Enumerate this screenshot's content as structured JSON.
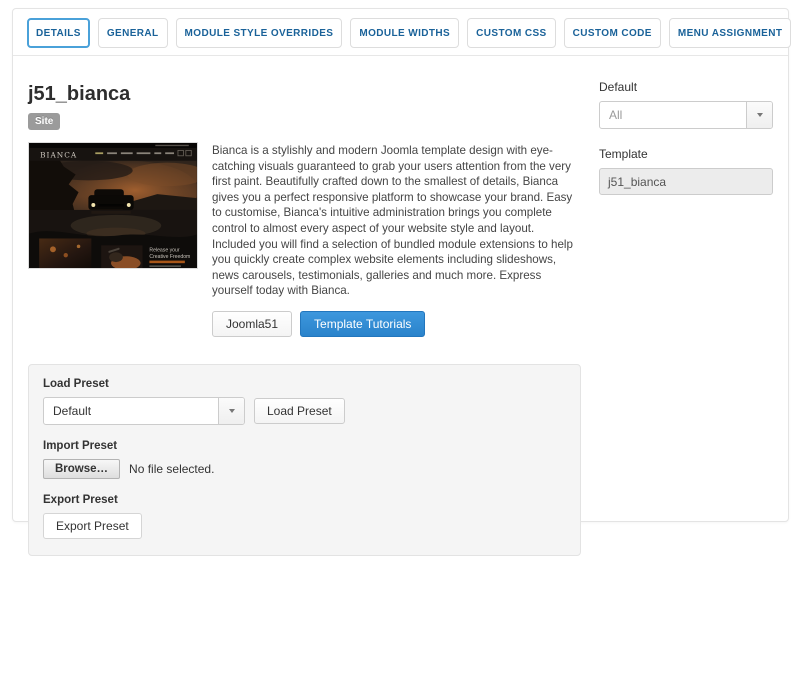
{
  "tabs": [
    {
      "label": "DETAILS",
      "active": true
    },
    {
      "label": "GENERAL",
      "active": false
    },
    {
      "label": "MODULE STYLE OVERRIDES",
      "active": false
    },
    {
      "label": "MODULE WIDTHS",
      "active": false
    },
    {
      "label": "CUSTOM CSS",
      "active": false
    },
    {
      "label": "CUSTOM CODE",
      "active": false
    },
    {
      "label": "MENU ASSIGNMENT",
      "active": false
    }
  ],
  "header": {
    "title": "j51_bianca",
    "badge": "Site"
  },
  "description": "Bianca is a stylishly and modern Joomla template design with eye-catching visuals guaranteed to grab your users attention from the very first paint. Beautifully crafted down to the smallest of details, Bianca gives you a perfect responsive platform to showcase your brand. Easy to customise, Bianca's intuitive administration brings you complete control to almost every aspect of your website style and layout. Included you will find a selection of bundled module extensions to help you quickly create complex website elements including slideshows, news carousels, testimonials, galleries and much more. Express yourself today with Bianca.",
  "actions": {
    "joomla51": "Joomla51",
    "tutorials": "Template Tutorials"
  },
  "sidebar": {
    "default_label": "Default",
    "default_value": "All",
    "template_label": "Template",
    "template_value": "j51_bianca"
  },
  "presets": {
    "load_label": "Load Preset",
    "load_value": "Default",
    "load_button": "Load Preset",
    "import_label": "Import Preset",
    "browse_button": "Browse…",
    "file_status": "No file selected.",
    "export_label": "Export Preset",
    "export_button": "Export Preset"
  },
  "thumbnail": {
    "logo": "BIANCA",
    "tagline_1": "Release your",
    "tagline_2": "Creative Freedom"
  },
  "colors": {
    "tab_text": "#1a6299",
    "active_tab_border": "#4aa1d9",
    "primary_button": "#2d8cd6",
    "badge_bg": "#9b9b9b",
    "panel_bg": "#f5f5f5",
    "panel_border": "#e3e3e3"
  }
}
